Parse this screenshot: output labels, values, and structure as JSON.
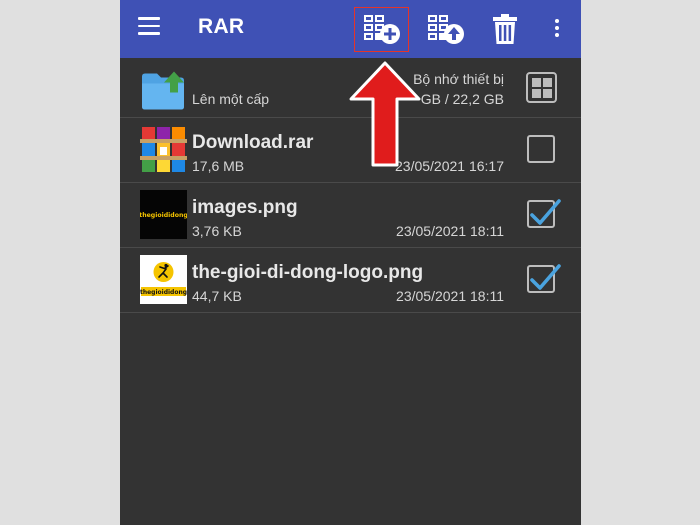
{
  "appbar": {
    "title": "RAR",
    "color": "#3f51b5",
    "icons": [
      "menu-icon",
      "archive-add-icon",
      "archive-extract-icon",
      "trash-icon",
      "more-vertical-icon"
    ]
  },
  "up_row": {
    "label": "Lên một cấp",
    "storage_name": "Bộ nhớ thiết bị",
    "storage_size": "GB / 22,2 GB"
  },
  "files": [
    {
      "name": "Download.rar",
      "size": "17,6 MB",
      "date": "23/05/2021 16:17",
      "checked": false
    },
    {
      "name": "images.png",
      "size": "3,76 KB",
      "date": "23/05/2021 18:11",
      "checked": true
    },
    {
      "name": "the-gioi-di-dong-logo.png",
      "size": "44,7 KB",
      "date": "23/05/2021 18:11",
      "checked": true
    }
  ],
  "thumb_text": {
    "images": "thegioididong",
    "logo": "thegioididong"
  },
  "colors": {
    "background": "#333333",
    "checkmark": "#4aa3df",
    "annotation": "#e5342a"
  }
}
